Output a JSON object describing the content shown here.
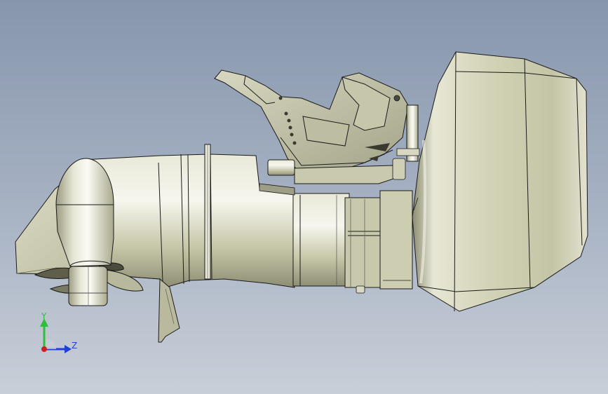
{
  "viewport": {
    "background_top": "#8796ad",
    "background_bottom": "#c9cfd8"
  },
  "model": {
    "body_fill": "#cfcfb2",
    "shadow_fill": "#9a9a80",
    "highlight_fill": "#f4f4ea",
    "edge_color": "#1a1a1a"
  },
  "triad": {
    "y_label": "Y",
    "z_label": "Z",
    "y_color": "#2fbf3a",
    "z_color": "#1f3fd8",
    "x_color": "#d01f1f"
  }
}
